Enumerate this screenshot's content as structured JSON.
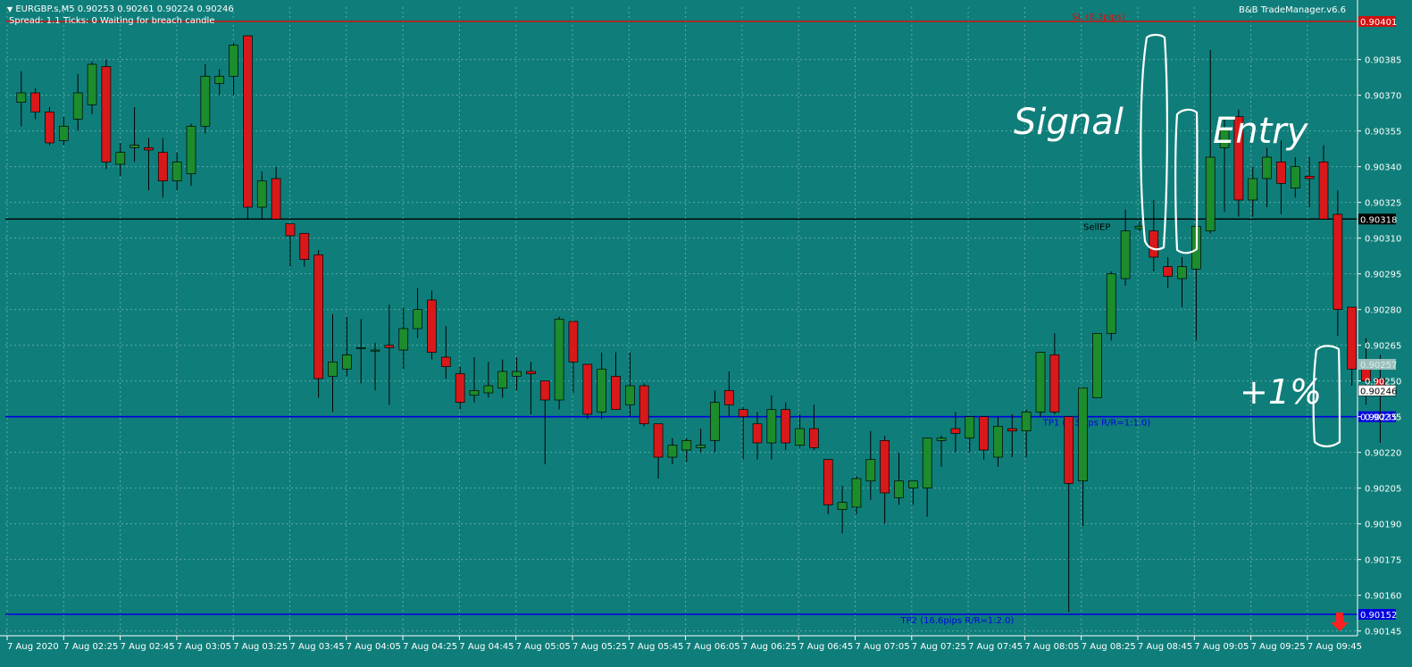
{
  "header": {
    "symbol_line": "EURGBP.s,M5  0.90253 0.90261 0.90224 0.90246",
    "status_line": "Spread: 1.1   Ticks: 0   Waiting for breach candle",
    "indicator": "B&B TradeManager.v6.6",
    "menu_arrow_icon": "triangle-down-icon"
  },
  "colors": {
    "background": "#0F7E7A",
    "bull": "#1C8C2C",
    "bear": "#D8181A",
    "sl": "#D01010",
    "tp": "#0000E0",
    "entry": "#000000",
    "grid": "#5FA8A4"
  },
  "annotations": {
    "signal": "Signal",
    "entry": "Entry",
    "result": "+1%",
    "sell_ep": "SellEP"
  },
  "chart_data": {
    "type": "candlestick",
    "symbol": "EURGBP.s",
    "timeframe": "M5",
    "ylim": [
      0.90143,
      0.90407
    ],
    "y_ticks": [
      "0.90385",
      "0.90370",
      "0.90355",
      "0.90340",
      "0.90325",
      "0.90310",
      "0.90295",
      "0.90280",
      "0.90265",
      "0.90250",
      "0.90235",
      "0.90220",
      "0.90205",
      "0.90190",
      "0.90175",
      "0.90160",
      "0.90145"
    ],
    "x_ticks": [
      "7 Aug 2020",
      "7 Aug 02:25",
      "7 Aug 02:45",
      "7 Aug 03:05",
      "7 Aug 03:25",
      "7 Aug 03:45",
      "7 Aug 04:05",
      "7 Aug 04:25",
      "7 Aug 04:45",
      "7 Aug 05:05",
      "7 Aug 05:25",
      "7 Aug 05:45",
      "7 Aug 06:05",
      "7 Aug 06:25",
      "7 Aug 06:45",
      "7 Aug 07:05",
      "7 Aug 07:25",
      "7 Aug 07:45",
      "7 Aug 08:05",
      "7 Aug 08:25",
      "7 Aug 08:45",
      "7 Aug 09:05",
      "7 Aug 09:25",
      "7 Aug 09:45"
    ],
    "levels": [
      {
        "name": "SL",
        "label": "SL (8.3pips)",
        "price": 0.90401,
        "tag": "0.90401",
        "role": "sl"
      },
      {
        "name": "Entry",
        "label": "SellEP",
        "price": 0.90318,
        "tag": "0.90318",
        "role": "entry"
      },
      {
        "name": "TP1",
        "label": "TP1 (8.3pips R/R=1:1.0)",
        "price": 0.90235,
        "tag": "0.90235",
        "role": "tp"
      },
      {
        "name": "TP2",
        "label": "TP2 (16.6pips R/R=1:2.0)",
        "price": 0.90152,
        "tag": "0.90152",
        "role": "tp"
      }
    ],
    "price_tags": [
      {
        "label": "0.90257",
        "price": 0.90257,
        "style": "faint"
      },
      {
        "label": "0.90246",
        "price": 0.90246,
        "style": "current"
      }
    ],
    "candles": [
      {
        "o": 0.90367,
        "h": 0.9038,
        "l": 0.90357,
        "c": 0.90371
      },
      {
        "o": 0.90371,
        "h": 0.90373,
        "l": 0.9036,
        "c": 0.90363
      },
      {
        "o": 0.90363,
        "h": 0.90365,
        "l": 0.90349,
        "c": 0.9035
      },
      {
        "o": 0.90351,
        "h": 0.90361,
        "l": 0.90349,
        "c": 0.90357
      },
      {
        "o": 0.9036,
        "h": 0.90379,
        "l": 0.90355,
        "c": 0.90371
      },
      {
        "o": 0.90366,
        "h": 0.90384,
        "l": 0.90362,
        "c": 0.90383
      },
      {
        "o": 0.90382,
        "h": 0.90385,
        "l": 0.90339,
        "c": 0.90342
      },
      {
        "o": 0.90341,
        "h": 0.9035,
        "l": 0.90336,
        "c": 0.90346
      },
      {
        "o": 0.90348,
        "h": 0.90365,
        "l": 0.90342,
        "c": 0.90349
      },
      {
        "o": 0.90348,
        "h": 0.90352,
        "l": 0.9033,
        "c": 0.90347
      },
      {
        "o": 0.90346,
        "h": 0.90352,
        "l": 0.90327,
        "c": 0.90334
      },
      {
        "o": 0.90334,
        "h": 0.90346,
        "l": 0.9033,
        "c": 0.90342
      },
      {
        "o": 0.90337,
        "h": 0.90358,
        "l": 0.90332,
        "c": 0.90357
      },
      {
        "o": 0.90357,
        "h": 0.90383,
        "l": 0.90354,
        "c": 0.90378
      },
      {
        "o": 0.90375,
        "h": 0.90381,
        "l": 0.9037,
        "c": 0.90378
      },
      {
        "o": 0.90378,
        "h": 0.90392,
        "l": 0.9037,
        "c": 0.90391
      },
      {
        "o": 0.90395,
        "h": 0.90395,
        "l": 0.90318,
        "c": 0.90323
      },
      {
        "o": 0.90323,
        "h": 0.90338,
        "l": 0.90318,
        "c": 0.90334
      },
      {
        "o": 0.90335,
        "h": 0.9034,
        "l": 0.90318,
        "c": 0.90318
      },
      {
        "o": 0.90316,
        "h": 0.90316,
        "l": 0.90298,
        "c": 0.90311
      },
      {
        "o": 0.90312,
        "h": 0.90312,
        "l": 0.90298,
        "c": 0.90301
      },
      {
        "o": 0.90303,
        "h": 0.90305,
        "l": 0.90243,
        "c": 0.90251
      },
      {
        "o": 0.90252,
        "h": 0.90278,
        "l": 0.90237,
        "c": 0.90258
      },
      {
        "o": 0.90255,
        "h": 0.90277,
        "l": 0.90252,
        "c": 0.90261
      },
      {
        "o": 0.90264,
        "h": 0.90276,
        "l": 0.90249,
        "c": 0.90264
      },
      {
        "o": 0.90263,
        "h": 0.90266,
        "l": 0.90246,
        "c": 0.90263
      },
      {
        "o": 0.90265,
        "h": 0.90282,
        "l": 0.9024,
        "c": 0.90264
      },
      {
        "o": 0.90263,
        "h": 0.90281,
        "l": 0.90255,
        "c": 0.90272
      },
      {
        "o": 0.90272,
        "h": 0.90289,
        "l": 0.90268,
        "c": 0.9028
      },
      {
        "o": 0.90284,
        "h": 0.90288,
        "l": 0.90259,
        "c": 0.90262
      },
      {
        "o": 0.9026,
        "h": 0.90273,
        "l": 0.90251,
        "c": 0.90256
      },
      {
        "o": 0.90253,
        "h": 0.90256,
        "l": 0.90238,
        "c": 0.90241
      },
      {
        "o": 0.90244,
        "h": 0.9026,
        "l": 0.90241,
        "c": 0.90246
      },
      {
        "o": 0.90245,
        "h": 0.90258,
        "l": 0.90243,
        "c": 0.90248
      },
      {
        "o": 0.90247,
        "h": 0.90259,
        "l": 0.90243,
        "c": 0.90254
      },
      {
        "o": 0.90252,
        "h": 0.9026,
        "l": 0.90246,
        "c": 0.90254
      },
      {
        "o": 0.90254,
        "h": 0.90258,
        "l": 0.90236,
        "c": 0.90253
      },
      {
        "o": 0.9025,
        "h": 0.9025,
        "l": 0.90215,
        "c": 0.90242
      },
      {
        "o": 0.90242,
        "h": 0.90277,
        "l": 0.90238,
        "c": 0.90276
      },
      {
        "o": 0.90275,
        "h": 0.90275,
        "l": 0.90245,
        "c": 0.90258
      },
      {
        "o": 0.90257,
        "h": 0.90257,
        "l": 0.90234,
        "c": 0.90236
      },
      {
        "o": 0.90237,
        "h": 0.90262,
        "l": 0.90234,
        "c": 0.90255
      },
      {
        "o": 0.90252,
        "h": 0.90262,
        "l": 0.9024,
        "c": 0.90238
      },
      {
        "o": 0.9024,
        "h": 0.90262,
        "l": 0.90235,
        "c": 0.90248
      },
      {
        "o": 0.90248,
        "h": 0.90249,
        "l": 0.90231,
        "c": 0.90232
      },
      {
        "o": 0.90232,
        "h": 0.90232,
        "l": 0.90209,
        "c": 0.90218
      },
      {
        "o": 0.90218,
        "h": 0.90226,
        "l": 0.90215,
        "c": 0.90223
      },
      {
        "o": 0.90221,
        "h": 0.90226,
        "l": 0.90216,
        "c": 0.90225
      },
      {
        "o": 0.90222,
        "h": 0.9023,
        "l": 0.9022,
        "c": 0.90223
      },
      {
        "o": 0.90225,
        "h": 0.90246,
        "l": 0.9022,
        "c": 0.90241
      },
      {
        "o": 0.90246,
        "h": 0.90254,
        "l": 0.90235,
        "c": 0.9024
      },
      {
        "o": 0.90238,
        "h": 0.90239,
        "l": 0.90217,
        "c": 0.90235
      },
      {
        "o": 0.90232,
        "h": 0.90237,
        "l": 0.90217,
        "c": 0.90224
      },
      {
        "o": 0.90224,
        "h": 0.90244,
        "l": 0.90217,
        "c": 0.90238
      },
      {
        "o": 0.90238,
        "h": 0.90241,
        "l": 0.90221,
        "c": 0.90224
      },
      {
        "o": 0.90223,
        "h": 0.90236,
        "l": 0.90222,
        "c": 0.9023
      },
      {
        "o": 0.9023,
        "h": 0.9024,
        "l": 0.90221,
        "c": 0.90222
      },
      {
        "o": 0.90217,
        "h": 0.90217,
        "l": 0.90194,
        "c": 0.90198
      },
      {
        "o": 0.90196,
        "h": 0.90206,
        "l": 0.90186,
        "c": 0.90199
      },
      {
        "o": 0.90197,
        "h": 0.9021,
        "l": 0.90194,
        "c": 0.90209
      },
      {
        "o": 0.90208,
        "h": 0.90229,
        "l": 0.902,
        "c": 0.90217
      },
      {
        "o": 0.90225,
        "h": 0.90227,
        "l": 0.9019,
        "c": 0.90203
      },
      {
        "o": 0.90201,
        "h": 0.9022,
        "l": 0.90198,
        "c": 0.90208
      },
      {
        "o": 0.90205,
        "h": 0.90208,
        "l": 0.90198,
        "c": 0.90208
      },
      {
        "o": 0.90205,
        "h": 0.90224,
        "l": 0.90193,
        "c": 0.90226
      },
      {
        "o": 0.90225,
        "h": 0.90227,
        "l": 0.90214,
        "c": 0.90226
      },
      {
        "o": 0.9023,
        "h": 0.90237,
        "l": 0.9022,
        "c": 0.90228
      },
      {
        "o": 0.90226,
        "h": 0.90235,
        "l": 0.9022,
        "c": 0.90235
      },
      {
        "o": 0.90235,
        "h": 0.90235,
        "l": 0.90217,
        "c": 0.90221
      },
      {
        "o": 0.90218,
        "h": 0.90235,
        "l": 0.90214,
        "c": 0.90231
      },
      {
        "o": 0.9023,
        "h": 0.90236,
        "l": 0.90218,
        "c": 0.90229
      },
      {
        "o": 0.90229,
        "h": 0.90238,
        "l": 0.90218,
        "c": 0.90237
      },
      {
        "o": 0.90237,
        "h": 0.90262,
        "l": 0.90235,
        "c": 0.90262
      },
      {
        "o": 0.90261,
        "h": 0.9027,
        "l": 0.90236,
        "c": 0.90237
      },
      {
        "o": 0.90235,
        "h": 0.90235,
        "l": 0.90153,
        "c": 0.90207
      },
      {
        "o": 0.90208,
        "h": 0.90241,
        "l": 0.90189,
        "c": 0.90247
      },
      {
        "o": 0.90243,
        "h": 0.9027,
        "l": 0.90243,
        "c": 0.9027
      },
      {
        "o": 0.9027,
        "h": 0.90296,
        "l": 0.90267,
        "c": 0.90295
      },
      {
        "o": 0.90293,
        "h": 0.90322,
        "l": 0.9029,
        "c": 0.90313
      },
      {
        "o": 0.90314,
        "h": 0.90317,
        "l": 0.90313,
        "c": 0.90315
      },
      {
        "o": 0.90313,
        "h": 0.90326,
        "l": 0.90296,
        "c": 0.90302
      },
      {
        "o": 0.90298,
        "h": 0.90302,
        "l": 0.90289,
        "c": 0.90294
      },
      {
        "o": 0.90293,
        "h": 0.90302,
        "l": 0.90281,
        "c": 0.90298
      },
      {
        "o": 0.90297,
        "h": 0.90316,
        "l": 0.90267,
        "c": 0.90315
      },
      {
        "o": 0.90313,
        "h": 0.90389,
        "l": 0.90312,
        "c": 0.90344
      },
      {
        "o": 0.90348,
        "h": 0.90361,
        "l": 0.90321,
        "c": 0.90356
      },
      {
        "o": 0.90361,
        "h": 0.90364,
        "l": 0.90319,
        "c": 0.90326
      },
      {
        "o": 0.90326,
        "h": 0.9034,
        "l": 0.90319,
        "c": 0.90335
      },
      {
        "o": 0.90335,
        "h": 0.90348,
        "l": 0.90323,
        "c": 0.90344
      },
      {
        "o": 0.90342,
        "h": 0.90351,
        "l": 0.9032,
        "c": 0.90333
      },
      {
        "o": 0.90331,
        "h": 0.90344,
        "l": 0.90327,
        "c": 0.9034
      },
      {
        "o": 0.90336,
        "h": 0.90344,
        "l": 0.90323,
        "c": 0.90335
      },
      {
        "o": 0.90342,
        "h": 0.90349,
        "l": 0.90321,
        "c": 0.90318
      },
      {
        "o": 0.9032,
        "h": 0.9033,
        "l": 0.90269,
        "c": 0.9028
      },
      {
        "o": 0.90281,
        "h": 0.9028,
        "l": 0.90248,
        "c": 0.90255
      },
      {
        "o": 0.90258,
        "h": 0.90268,
        "l": 0.9024,
        "c": 0.9025
      },
      {
        "o": 0.90251,
        "h": 0.90261,
        "l": 0.90224,
        "c": 0.90246
      }
    ]
  }
}
